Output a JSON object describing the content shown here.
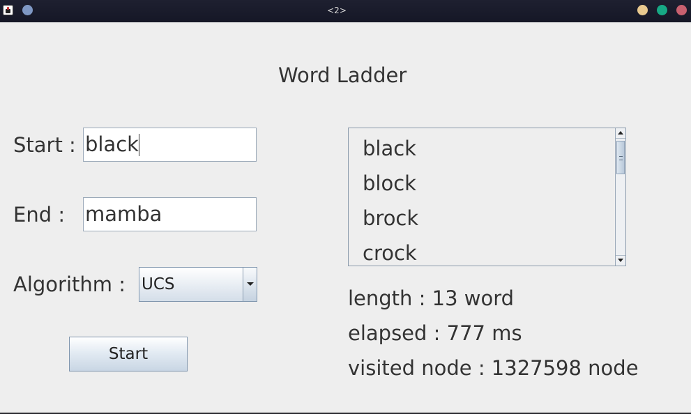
{
  "window": {
    "title": "<2>"
  },
  "app": {
    "heading": "Word Ladder"
  },
  "form": {
    "start_label": "Start :",
    "start_value": "black",
    "end_label": "End :",
    "end_value": "mamba",
    "algorithm_label": "Algorithm :",
    "algorithm_value": "UCS",
    "start_button": "Start"
  },
  "result": {
    "items": [
      "black",
      "block",
      "brock",
      "crock"
    ],
    "length": "length : 13 word",
    "elapsed": "elapsed : 777 ms",
    "visited": "visited node : 1327598 node"
  },
  "icons": {
    "app": "java-app-icon",
    "pin": "pin-icon",
    "minimize": "minimize-icon",
    "maximize": "maximize-icon",
    "close": "close-icon"
  },
  "colors": {
    "titlebar": "#1a1c2b",
    "background": "#eeeeee",
    "minimize": "#e8c98f",
    "maximize": "#17a985",
    "close": "#c8606f"
  }
}
